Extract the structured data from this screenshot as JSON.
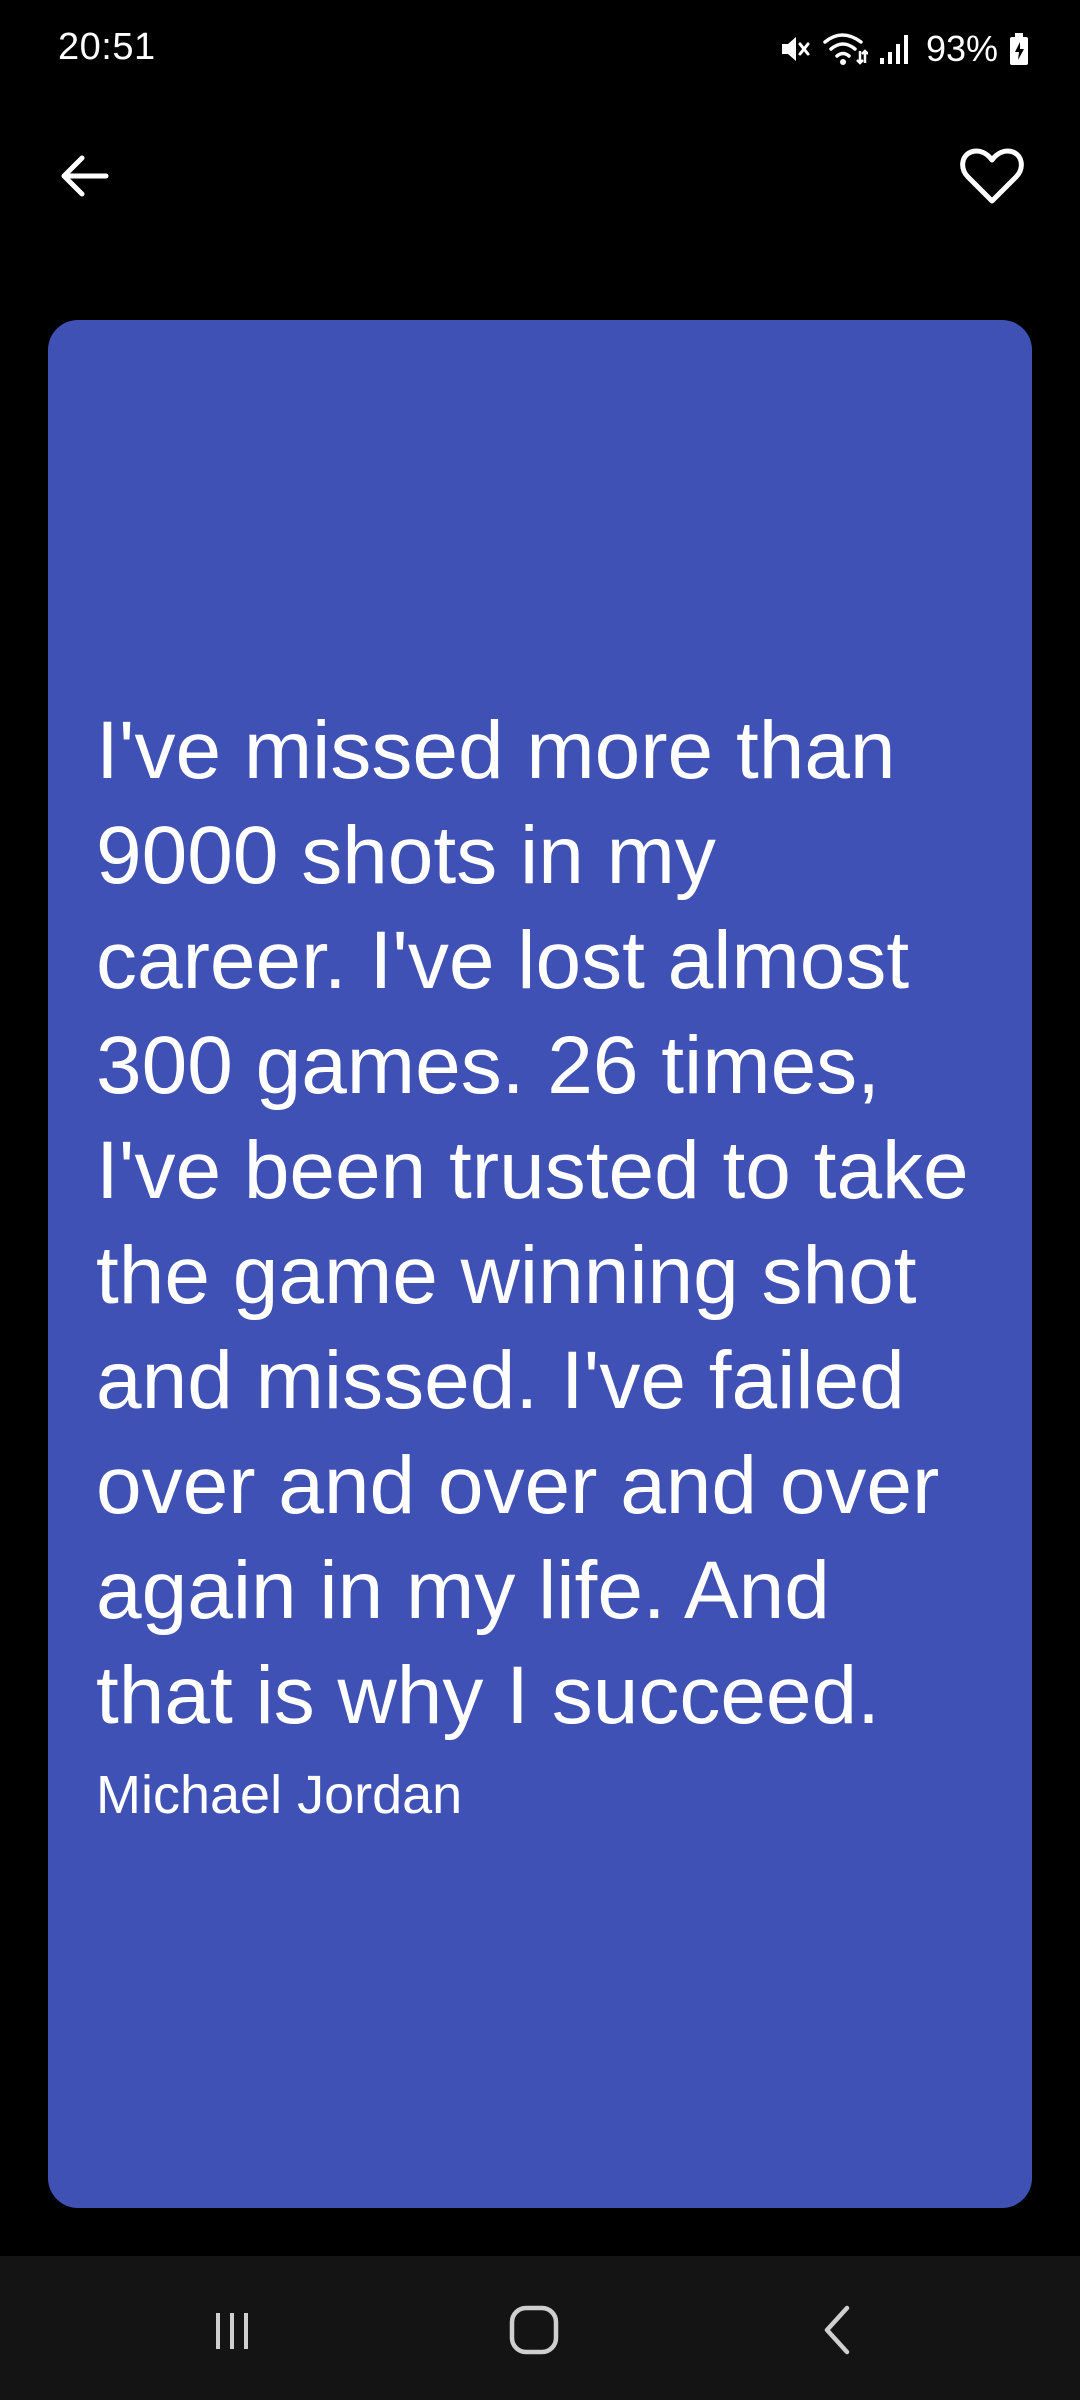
{
  "status_bar": {
    "time": "20:51",
    "battery": "93%",
    "icons": [
      "mute-icon",
      "wifi-icon",
      "signal-icon",
      "battery-charging-icon"
    ]
  },
  "app_bar": {
    "back_icon": "arrow-back-icon",
    "favorite_icon": "heart-outline-icon"
  },
  "quote": {
    "text": "I've missed more than 9000 shots in my career. I've lost almost 300 games. 26 times, I've been trusted to take the game winning shot and missed. I've failed over and over and over again in my life. And that is why I succeed.",
    "author": "Michael Jordan",
    "card_color": "#3f51b5"
  },
  "nav_bar": {
    "icons": [
      "recents-icon",
      "home-icon",
      "back-icon"
    ]
  }
}
